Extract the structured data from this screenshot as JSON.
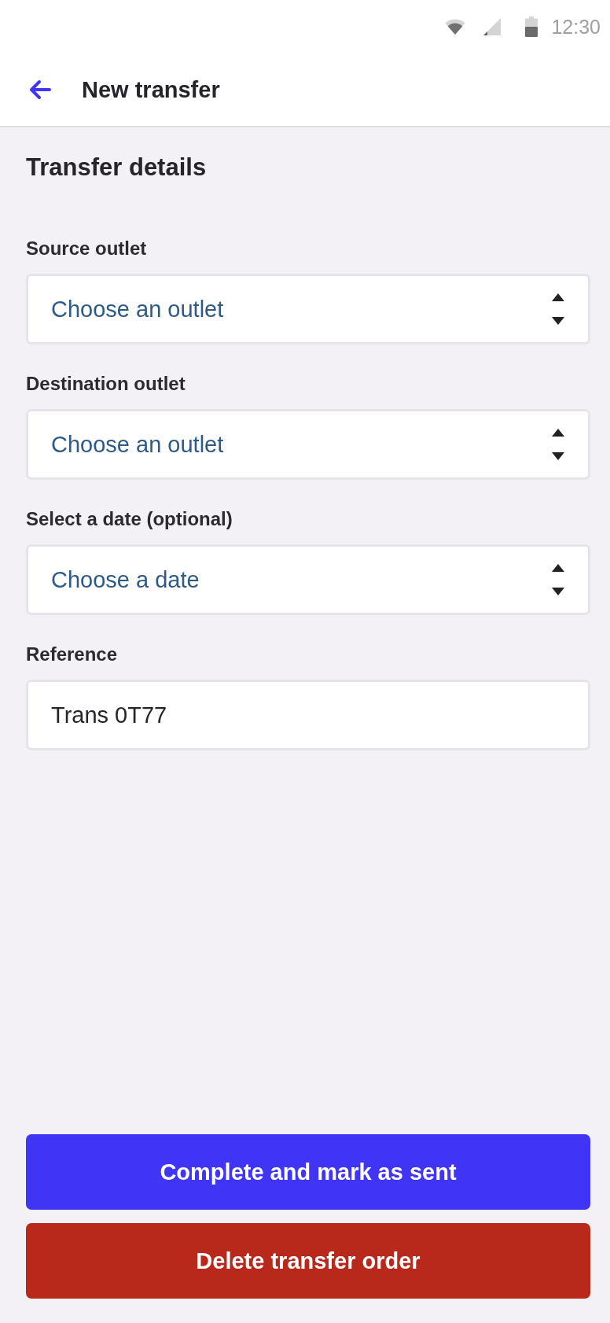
{
  "status_bar": {
    "time": "12:30"
  },
  "app_bar": {
    "title": "New transfer"
  },
  "section": {
    "title": "Transfer details"
  },
  "fields": [
    {
      "kind": "select",
      "label": "Source outlet",
      "placeholder": "Choose an outlet"
    },
    {
      "kind": "select",
      "label": "Destination outlet",
      "placeholder": "Choose an outlet"
    },
    {
      "kind": "select",
      "label": "Select a date (optional)",
      "placeholder": "Choose a date"
    },
    {
      "kind": "text",
      "label": "Reference",
      "value": "Trans 0T77"
    }
  ],
  "buttons": [
    {
      "kind": "primary",
      "label": "Complete and mark as sent"
    },
    {
      "kind": "danger",
      "label": "Delete transfer order"
    }
  ]
}
